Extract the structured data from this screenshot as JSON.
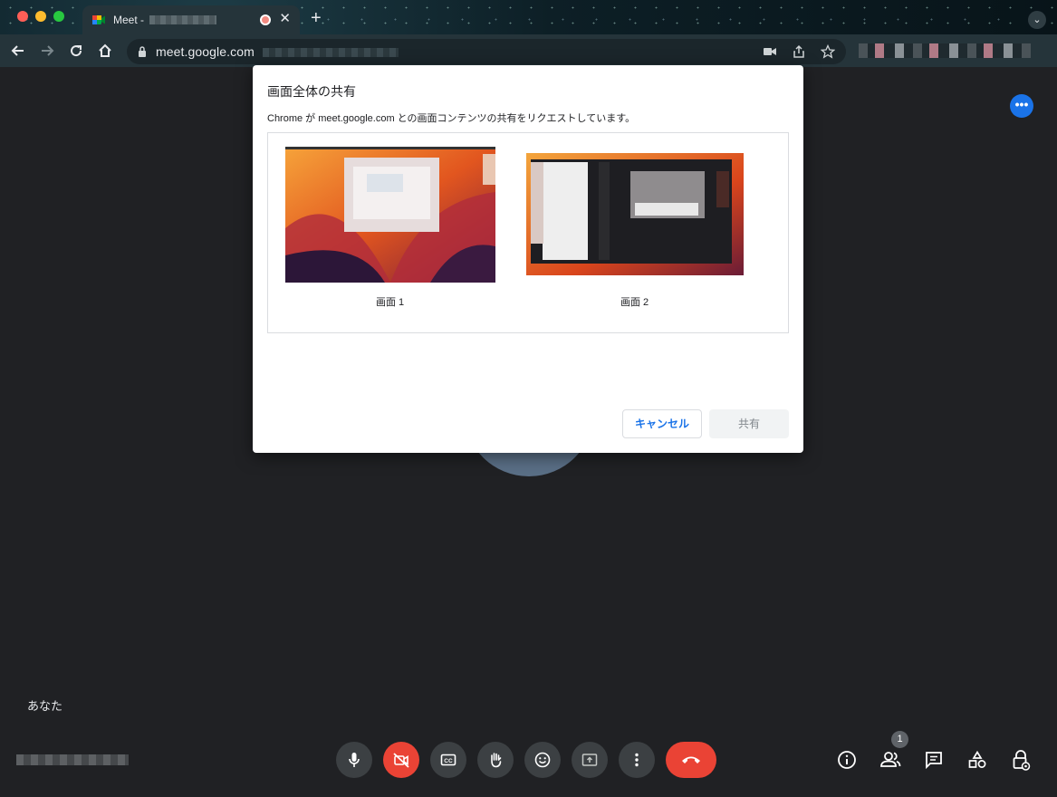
{
  "browser": {
    "tab_title": "Meet -",
    "url": "meet.google.com",
    "new_tab_label": "+",
    "tab_close_label": "✕"
  },
  "dialog": {
    "title": "画面全体の共有",
    "description": "Chrome が meet.google.com との画面コンテンツの共有をリクエストしています。",
    "screens": [
      {
        "label": "画面 1"
      },
      {
        "label": "画面 2"
      }
    ],
    "cancel_label": "キャンセル",
    "share_label": "共有"
  },
  "meeting": {
    "self_label": "あなた",
    "participant_count": "1"
  },
  "colors": {
    "accent": "#1a73e8",
    "danger": "#ea4335",
    "control_bg": "#3c4043",
    "background": "#202124"
  },
  "icons": {
    "controls": [
      "mic-icon",
      "camera-off-icon",
      "captions-icon",
      "raise-hand-icon",
      "emoji-icon",
      "present-icon",
      "more-vert-icon",
      "end-call-icon"
    ],
    "right": [
      "info-icon",
      "people-icon",
      "chat-icon",
      "activities-icon",
      "host-controls-icon"
    ]
  }
}
